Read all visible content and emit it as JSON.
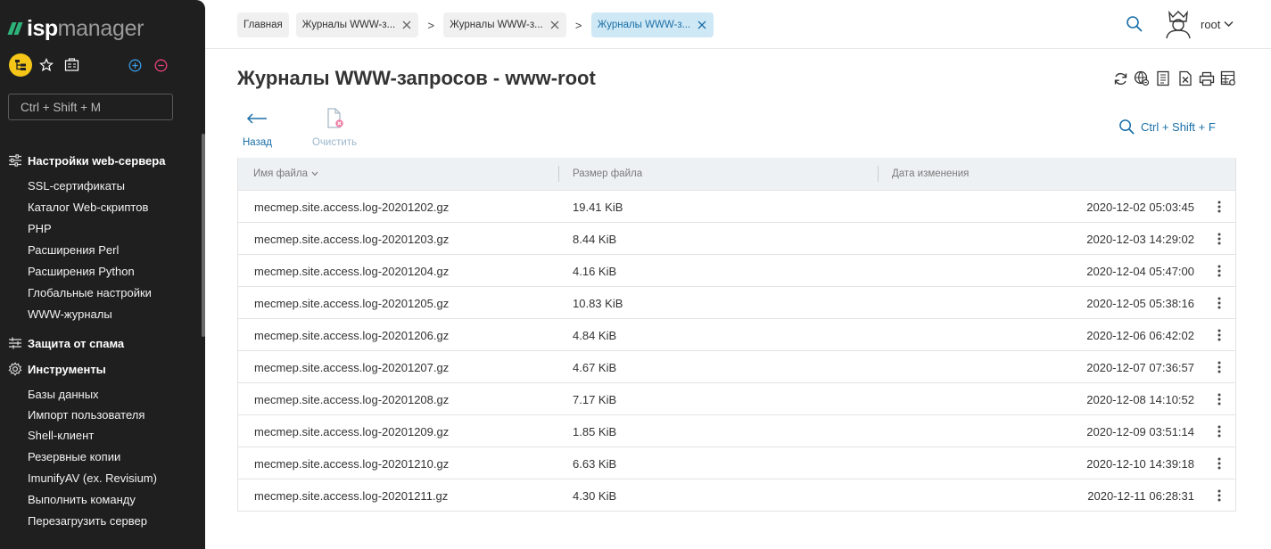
{
  "app": {
    "logo_isp": "isp",
    "logo_manager": "manager"
  },
  "sidebar": {
    "search_placeholder": "Ctrl + Shift + M",
    "groups": [
      {
        "label": "Настройки web-сервера",
        "icon": "sliders-icon",
        "items": [
          "SSL-сертификаты",
          "Каталог Web-скриптов",
          "PHP",
          "Расширения Perl",
          "Расширения Python",
          "Глобальные настройки",
          "WWW-журналы"
        ]
      },
      {
        "label": "Защита от спама",
        "icon": "spam-filter-icon",
        "items": []
      },
      {
        "label": "Инструменты",
        "icon": "gear-icon",
        "items": [
          "Базы данных",
          "Импорт пользователя",
          "Shell-клиент",
          "Резервные копии",
          "ImunifyAV (ex. Revisium)",
          "Выполнить команду",
          "Перезагрузить сервер"
        ]
      }
    ]
  },
  "breadcrumbs": [
    {
      "label": "Главная",
      "closable": false,
      "active": false
    },
    {
      "label": "Журналы WWW-з...",
      "closable": true,
      "active": false
    },
    {
      "label": "Журналы WWW-з...",
      "closable": true,
      "active": false
    },
    {
      "label": "Журналы WWW-з...",
      "closable": true,
      "active": true
    }
  ],
  "breadcrumb_separator": ">",
  "user": {
    "name": "root"
  },
  "page": {
    "title": "Журналы WWW-запросов - www-root",
    "back_label": "Назад",
    "clear_label": "Очистить",
    "filter_shortcut": "Ctrl + Shift + F"
  },
  "toolbar_icons": [
    "refresh-icon",
    "web-icon",
    "log-icon",
    "export-excel-icon",
    "print-icon",
    "settings-table-icon"
  ],
  "colors": {
    "accent": "#1b6fa8",
    "sidebar_bg": "#1f1f1f",
    "logo_green": "#2db37a",
    "active_crumb_bg": "#cfe8f5",
    "highlight_yellow": "#f5c518"
  },
  "table": {
    "columns": [
      "Имя файла",
      "Размер файла",
      "Дата изменения"
    ],
    "rows": [
      {
        "name": "mecmep.site.access.log-20201202.gz",
        "size": "19.41 KiB",
        "date": "2020-12-02 05:03:45"
      },
      {
        "name": "mecmep.site.access.log-20201203.gz",
        "size": "8.44 KiB",
        "date": "2020-12-03 14:29:02"
      },
      {
        "name": "mecmep.site.access.log-20201204.gz",
        "size": "4.16 KiB",
        "date": "2020-12-04 05:47:00"
      },
      {
        "name": "mecmep.site.access.log-20201205.gz",
        "size": "10.83 KiB",
        "date": "2020-12-05 05:38:16"
      },
      {
        "name": "mecmep.site.access.log-20201206.gz",
        "size": "4.84 KiB",
        "date": "2020-12-06 06:42:02"
      },
      {
        "name": "mecmep.site.access.log-20201207.gz",
        "size": "4.67 KiB",
        "date": "2020-12-07 07:36:57"
      },
      {
        "name": "mecmep.site.access.log-20201208.gz",
        "size": "7.17 KiB",
        "date": "2020-12-08 14:10:52"
      },
      {
        "name": "mecmep.site.access.log-20201209.gz",
        "size": "1.85 KiB",
        "date": "2020-12-09 03:51:14"
      },
      {
        "name": "mecmep.site.access.log-20201210.gz",
        "size": "6.63 KiB",
        "date": "2020-12-10 14:39:18"
      },
      {
        "name": "mecmep.site.access.log-20201211.gz",
        "size": "4.30 KiB",
        "date": "2020-12-11 06:28:31"
      }
    ]
  }
}
